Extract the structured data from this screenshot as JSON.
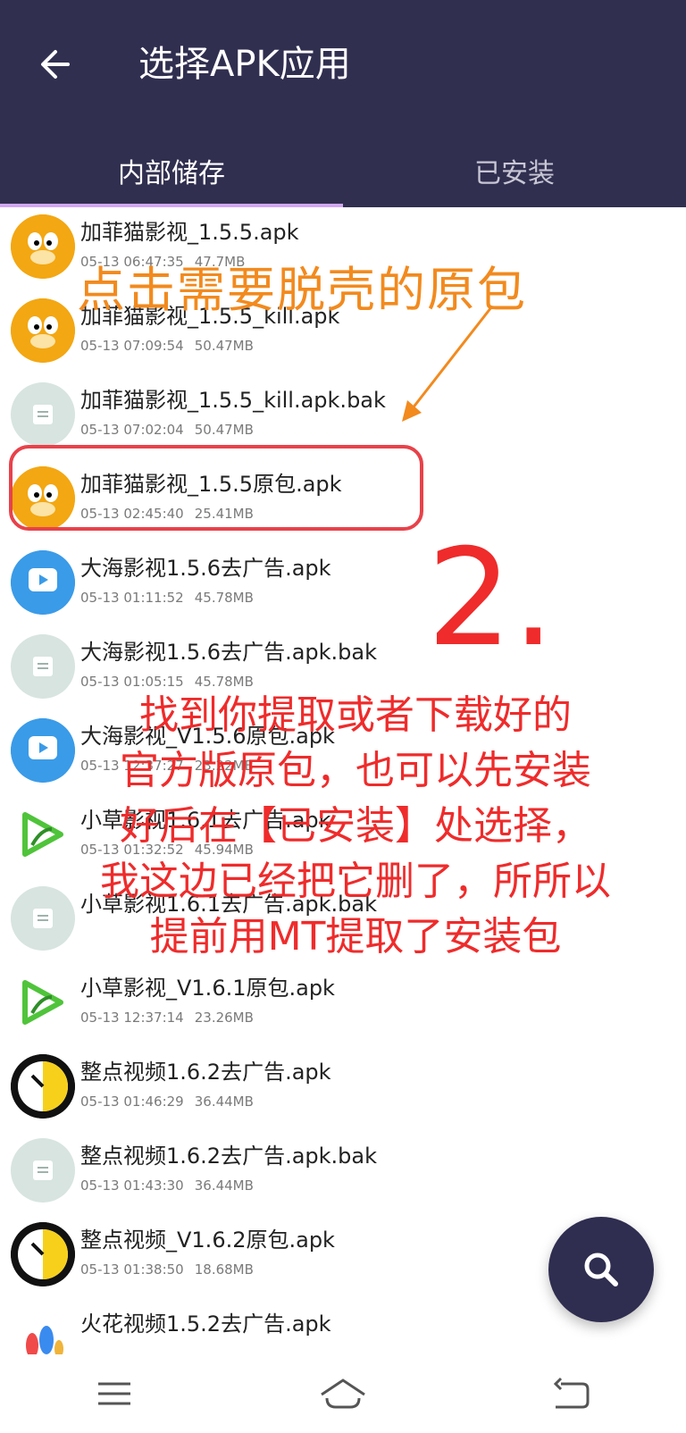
{
  "header": {
    "title": "选择APK应用"
  },
  "tabs": [
    {
      "label": "内部储存"
    },
    {
      "label": "已安装"
    }
  ],
  "files": [
    {
      "name": "加菲猫影视_1.5.5.apk",
      "date": "05-13 06:47:35",
      "size": "47.7MB",
      "icon": "garfield-icon"
    },
    {
      "name": "加菲猫影视_1.5.5_kill.apk",
      "date": "05-13 07:09:54",
      "size": "50.47MB",
      "icon": "garfield-icon"
    },
    {
      "name": "加菲猫影视_1.5.5_kill.apk.bak",
      "date": "05-13 07:02:04",
      "size": "50.47MB",
      "icon": "file-icon"
    },
    {
      "name": "加菲猫影视_1.5.5原包.apk",
      "date": "05-13 02:45:40",
      "size": "25.41MB",
      "icon": "garfield-icon"
    },
    {
      "name": "大海影视1.5.6去广告.apk",
      "date": "05-13 01:11:52",
      "size": "45.78MB",
      "icon": "dahai-icon"
    },
    {
      "name": "大海影视1.5.6去广告.apk.bak",
      "date": "05-13 01:05:15",
      "size": "45.78MB",
      "icon": "file-icon"
    },
    {
      "name": "大海影视_V1.5.6原包.apk",
      "date": "05-13 12:37:27",
      "size": "23.22MB",
      "icon": "dahai-icon"
    },
    {
      "name": "小草影视1.6.1去广告.apk",
      "date": "05-13 01:32:52",
      "size": "45.94MB",
      "icon": "xiaocao-icon"
    },
    {
      "name": "小草影视1.6.1去广告.apk.bak",
      "date": "",
      "size": "",
      "icon": "file-icon"
    },
    {
      "name": "小草影视_V1.6.1原包.apk",
      "date": "05-13 12:37:14",
      "size": "23.26MB",
      "icon": "xiaocao-icon"
    },
    {
      "name": "整点视频1.6.2去广告.apk",
      "date": "05-13 01:46:29",
      "size": "36.44MB",
      "icon": "zhengdian-icon"
    },
    {
      "name": "整点视频1.6.2去广告.apk.bak",
      "date": "05-13 01:43:30",
      "size": "36.44MB",
      "icon": "file-icon"
    },
    {
      "name": "整点视频_V1.6.2原包.apk",
      "date": "05-13 01:38:50",
      "size": "18.68MB",
      "icon": "zhengdian-icon"
    },
    {
      "name": "火花视频1.5.2去广告.apk",
      "date": "",
      "size": "",
      "icon": "huohua-icon"
    }
  ],
  "annotations": {
    "orange_text": "点击需要脱壳的原包",
    "red_number": "2.",
    "red_lines": [
      "找到你提取或者下载好的",
      "官方版原包，也可以先安装",
      "好后在【已安装】处选择，",
      "我这边已经把它删了，所所以",
      "提前用MT提取了安装包"
    ]
  },
  "colors": {
    "header_bg": "#312f50",
    "accent_indicator": "#d1a7f2",
    "annotation_orange": "#f28a1e",
    "annotation_red": "#ef2b2b",
    "fab_bg": "#2f2d50"
  },
  "icons": {
    "back": "arrow-left-icon",
    "fab": "search-icon",
    "nav": [
      "menu-icon",
      "home-icon",
      "back-nav-icon"
    ]
  }
}
